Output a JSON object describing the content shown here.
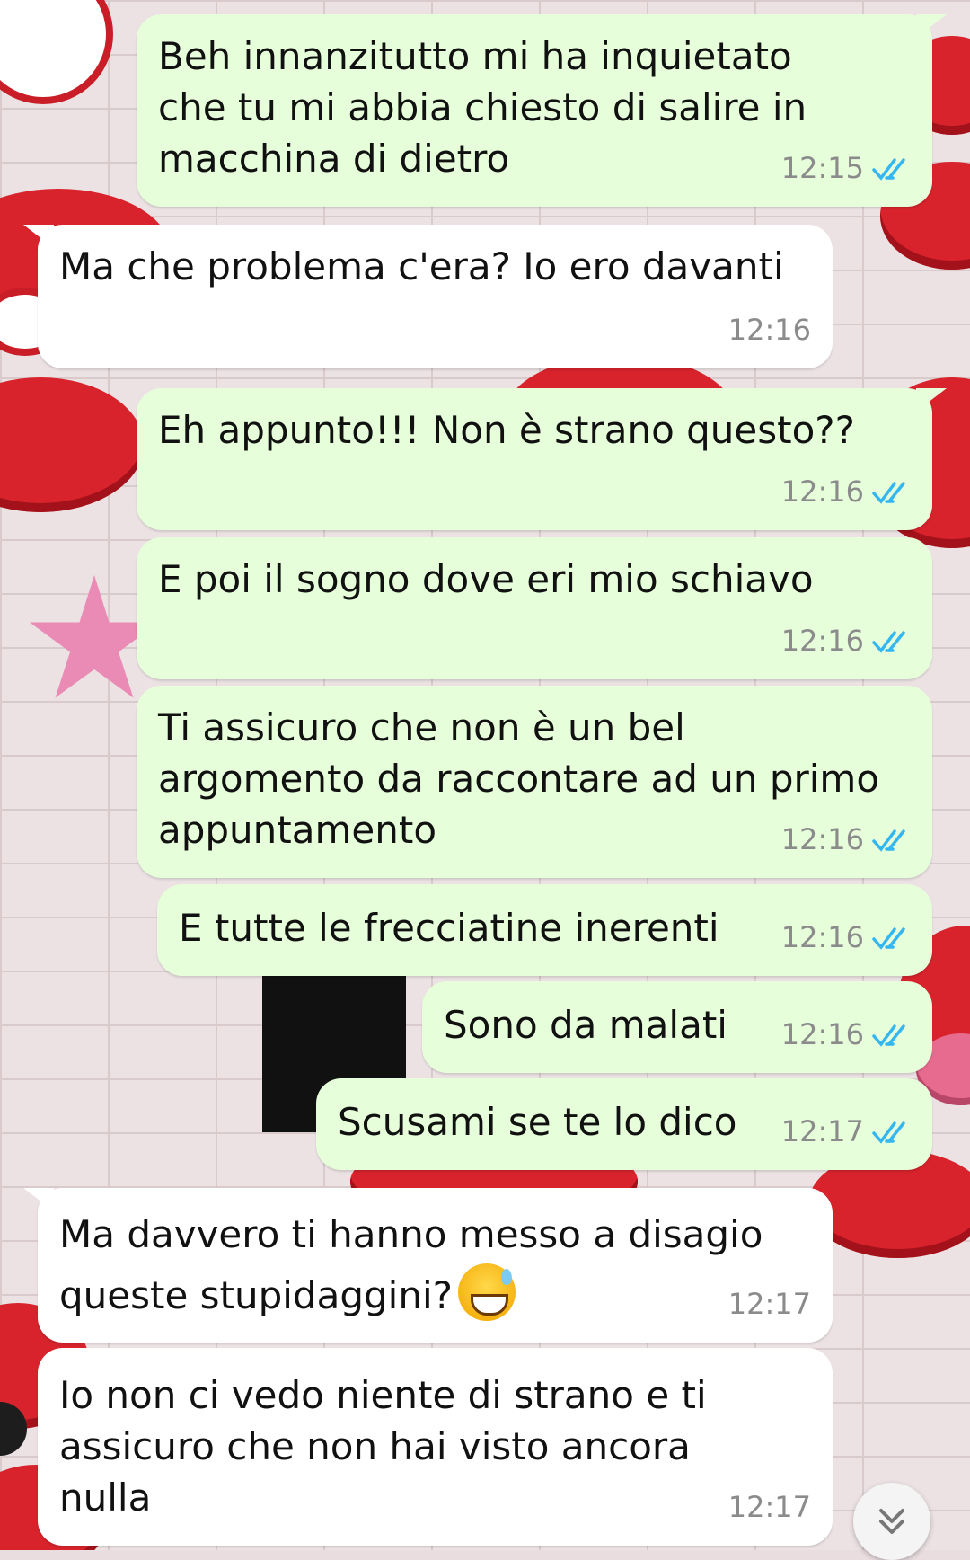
{
  "messages": [
    {
      "direction": "outgoing",
      "text": "Beh innanzitutto mi ha inquietato\nche tu mi abbia chiesto di salire in\nmacchina di dietro",
      "time": "12:15",
      "read": true
    },
    {
      "direction": "incoming",
      "text": "Ma che problema c'era? Io ero davanti",
      "time": "12:16"
    },
    {
      "direction": "outgoing",
      "text": "Eh appunto!!! Non è strano questo??",
      "time": "12:16",
      "read": true
    },
    {
      "direction": "outgoing",
      "text": "E poi il sogno dove eri mio schiavo",
      "time": "12:16",
      "read": true
    },
    {
      "direction": "outgoing",
      "text": "Ti assicuro che non è un bel\nargomento da raccontare ad un primo\nappuntamento",
      "time": "12:16",
      "read": true
    },
    {
      "direction": "outgoing",
      "text": "E tutte le frecciatine inerenti",
      "time": "12:16",
      "read": true
    },
    {
      "direction": "outgoing",
      "text": "Sono da malati",
      "time": "12:16",
      "read": true
    },
    {
      "direction": "outgoing",
      "text": "Scusami se te lo dico",
      "time": "12:17",
      "read": true
    },
    {
      "direction": "incoming",
      "text": "Ma davvero ti hanno messo a disagio\nqueste stupidaggini?",
      "emoji": "grinning-face-with-sweat",
      "time": "12:17"
    },
    {
      "direction": "incoming",
      "text": "Io non ci vedo niente di strano e ti\nassicuro che non hai visto ancora\nnulla",
      "time": "12:17"
    }
  ],
  "colors": {
    "outgoing_bubble": "#e6ffda",
    "incoming_bubble": "#ffffff",
    "read_ticks": "#34b7f1"
  },
  "scroll_button": {
    "icon": "chevron-double-down-icon"
  }
}
